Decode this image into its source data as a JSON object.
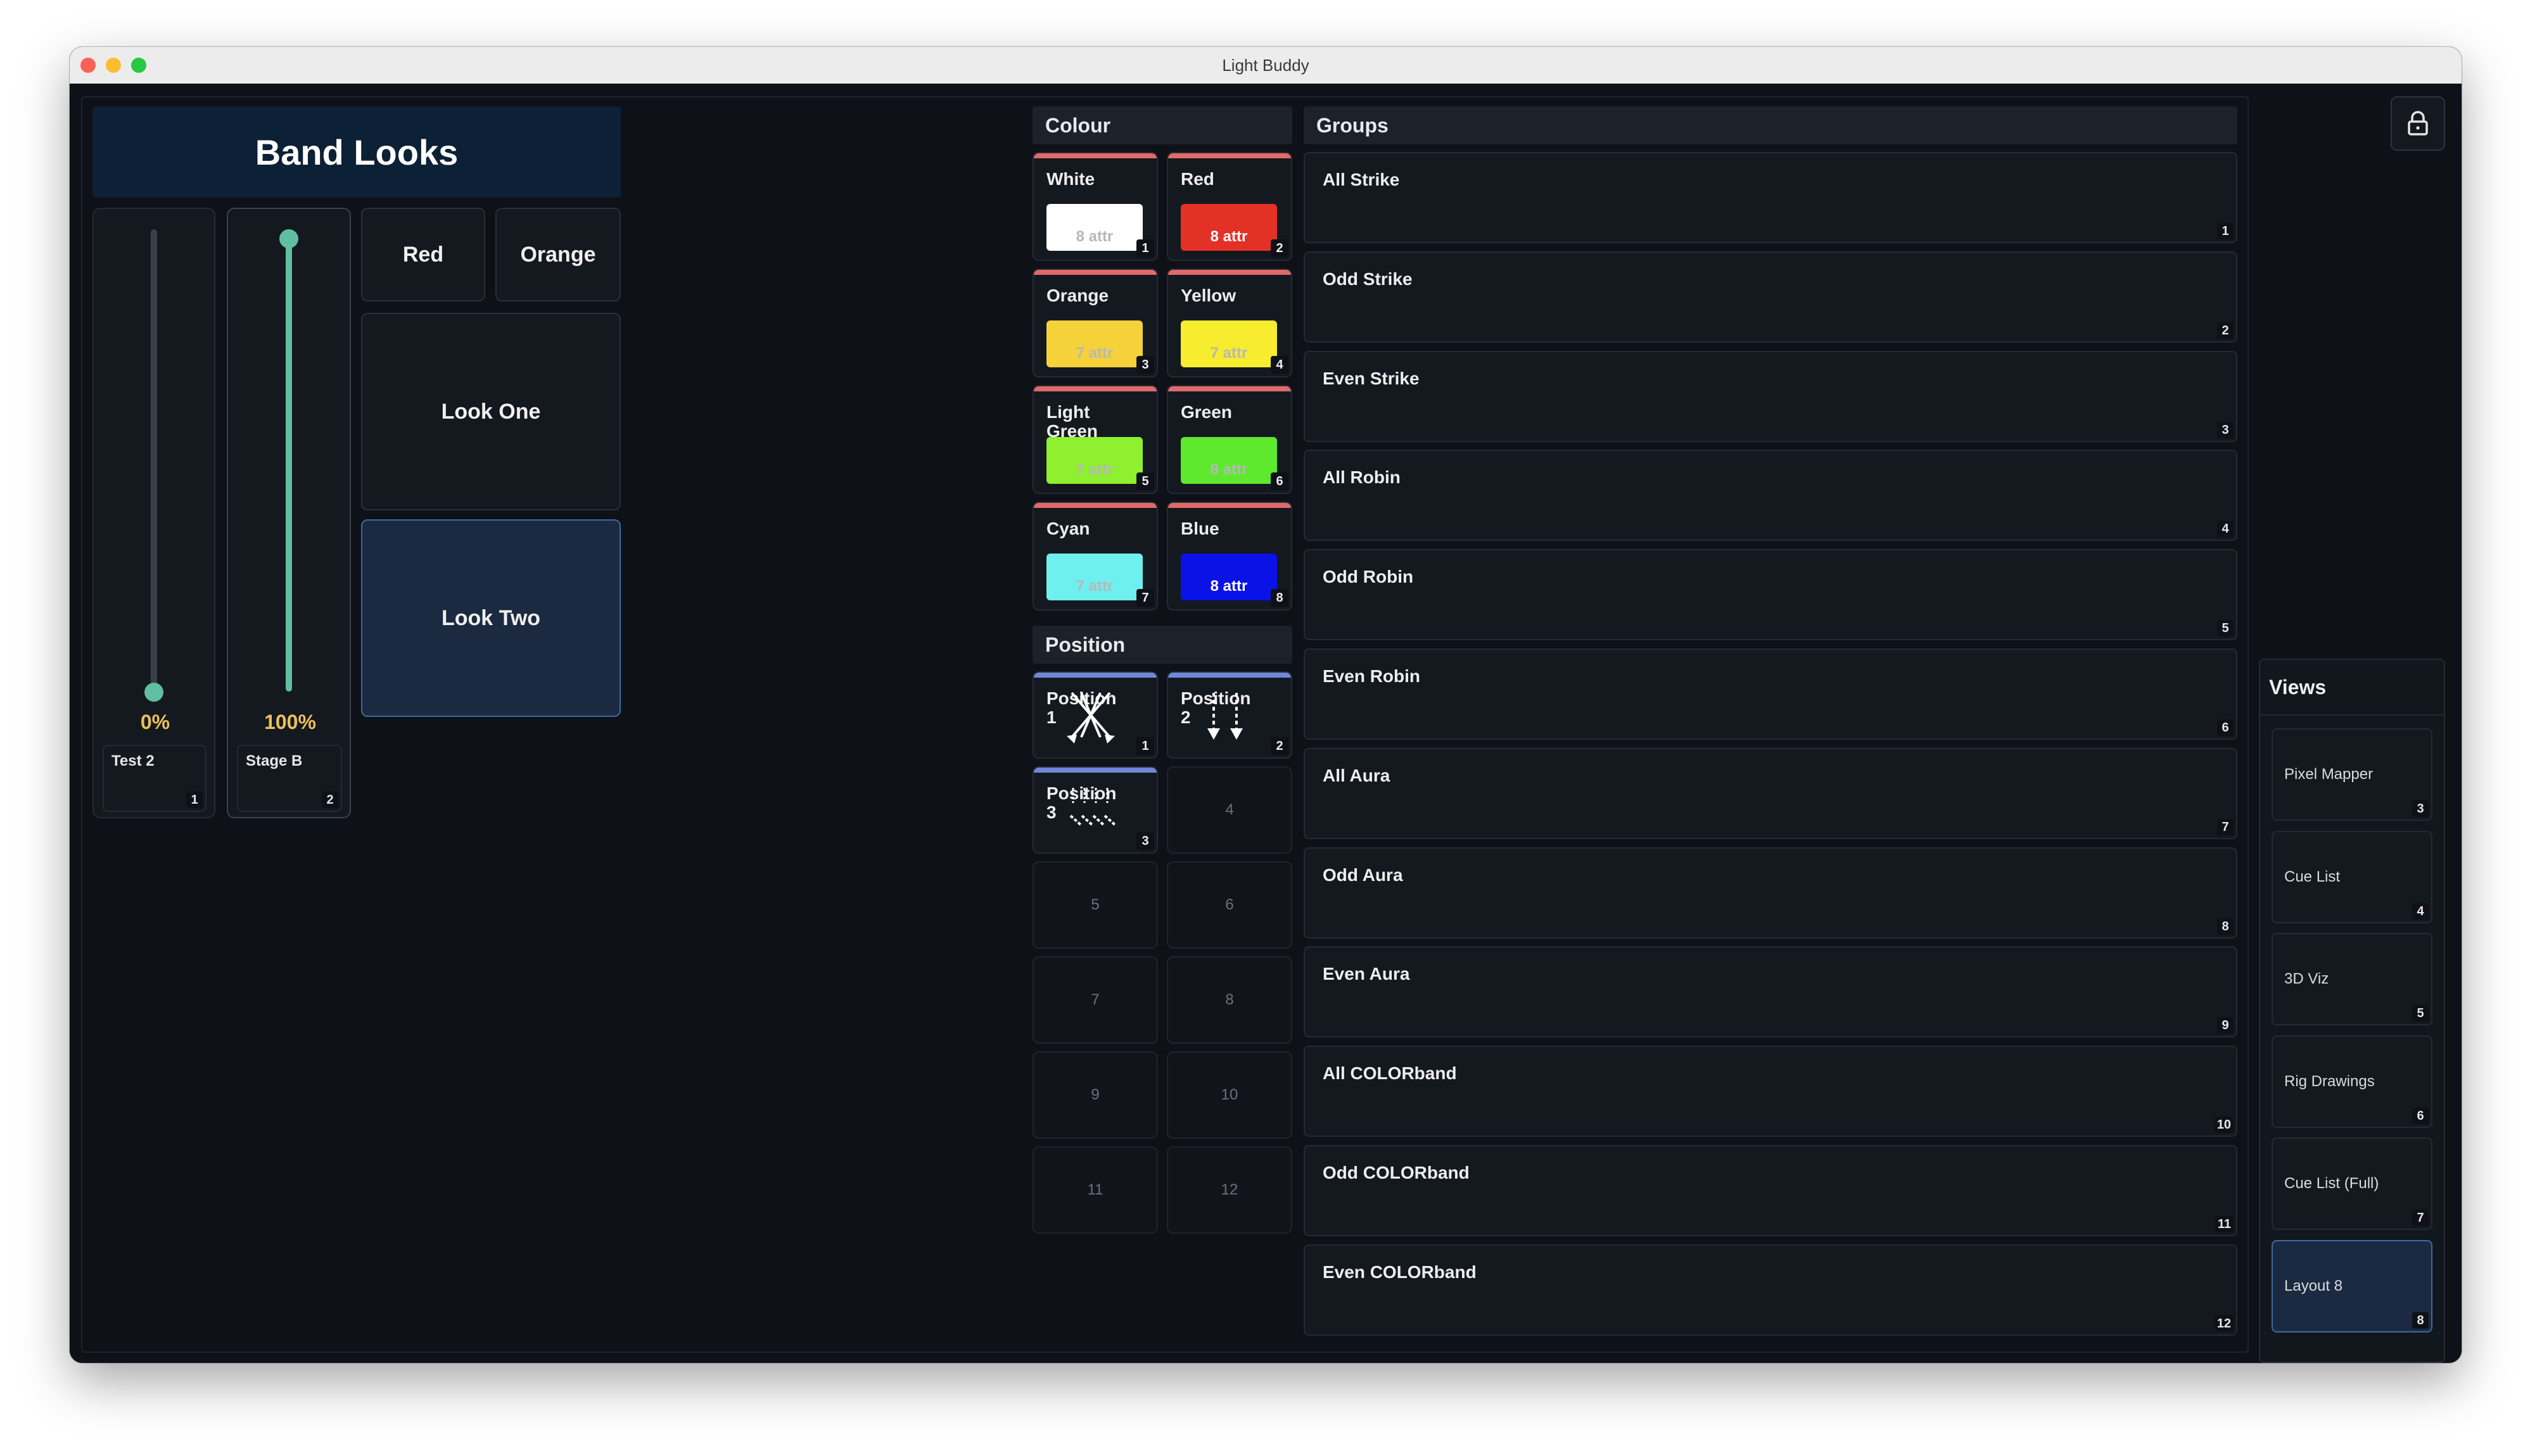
{
  "window": {
    "title": "Light Buddy"
  },
  "band_looks": {
    "title": "Band Looks",
    "faders": [
      {
        "label": "Test 2",
        "value": "0%",
        "level": 0.0,
        "num": "1"
      },
      {
        "label": "Stage B",
        "value": "100%",
        "level": 1.0,
        "num": "2"
      }
    ],
    "buttons": {
      "red": "Red",
      "orange": "Orange",
      "look_one": "Look One",
      "look_two": "Look Two"
    }
  },
  "colour": {
    "title": "Colour",
    "presets": [
      {
        "name": "White",
        "attr": "8 attr",
        "num": "1",
        "color": "#ffffff"
      },
      {
        "name": "Red",
        "attr": "8 attr",
        "num": "2",
        "color": "#e33126"
      },
      {
        "name": "Orange",
        "attr": "7 attr",
        "num": "3",
        "color": "#f5d23a"
      },
      {
        "name": "Yellow",
        "attr": "7 attr",
        "num": "4",
        "color": "#f7ec2d"
      },
      {
        "name": "Light Green",
        "attr": "7 attr",
        "num": "5",
        "color": "#8ef02e"
      },
      {
        "name": "Green",
        "attr": "8 attr",
        "num": "6",
        "color": "#5ee82e"
      },
      {
        "name": "Cyan",
        "attr": "7 attr",
        "num": "7",
        "color": "#6ef0ee"
      },
      {
        "name": "Blue",
        "attr": "8 attr",
        "num": "8",
        "color": "#0a12e8"
      }
    ]
  },
  "position": {
    "title": "Position",
    "presets": [
      {
        "name": "Position 1",
        "num": "1"
      },
      {
        "name": "Position 2",
        "num": "2"
      },
      {
        "name": "Position 3",
        "num": "3"
      }
    ],
    "empty": [
      "4",
      "5",
      "6",
      "7",
      "8",
      "9",
      "10",
      "11",
      "12"
    ]
  },
  "groups": {
    "title": "Groups",
    "items": [
      {
        "name": "All Strike",
        "num": "1"
      },
      {
        "name": "Odd Strike",
        "num": "2"
      },
      {
        "name": "Even Strike",
        "num": "3"
      },
      {
        "name": "All Robin",
        "num": "4"
      },
      {
        "name": "Odd Robin",
        "num": "5"
      },
      {
        "name": "Even Robin",
        "num": "6"
      },
      {
        "name": "All Aura",
        "num": "7"
      },
      {
        "name": "Odd Aura",
        "num": "8"
      },
      {
        "name": "Even Aura",
        "num": "9"
      },
      {
        "name": "All COLORband",
        "num": "10"
      },
      {
        "name": "Odd COLORband",
        "num": "11"
      },
      {
        "name": "Even COLORband",
        "num": "12"
      }
    ]
  },
  "views": {
    "title": "Views",
    "items": [
      {
        "name": "Pixel Mapper",
        "num": "3"
      },
      {
        "name": "Cue List",
        "num": "4"
      },
      {
        "name": "3D Viz",
        "num": "5"
      },
      {
        "name": "Rig Drawings",
        "num": "6"
      },
      {
        "name": "Cue List (Full)",
        "num": "7"
      },
      {
        "name": "Layout 8",
        "num": "8"
      }
    ]
  },
  "icons": {
    "lock": "lock-icon"
  }
}
